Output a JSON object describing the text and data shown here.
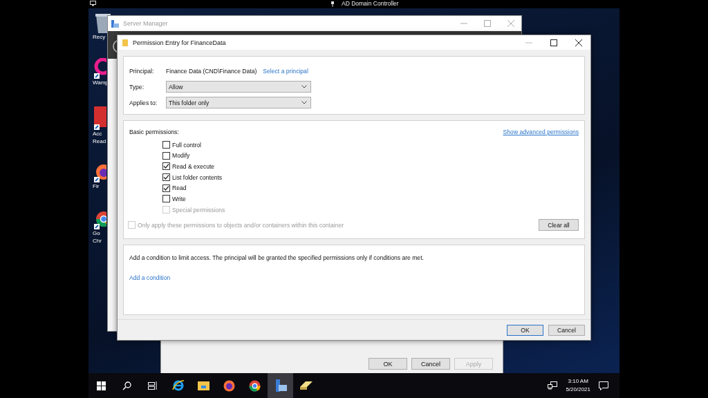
{
  "top_bar": {
    "title": "AD Domain Controller"
  },
  "desktop_icons": [
    {
      "kind": "recycle",
      "lines": [
        "Recy"
      ]
    },
    {
      "kind": "wamp",
      "lines": [
        "Wamp"
      ]
    },
    {
      "kind": "acrobat",
      "lines": [
        "Acc",
        "Read"
      ]
    },
    {
      "kind": "firefox",
      "lines": [
        "Fir"
      ]
    },
    {
      "kind": "chrome",
      "lines": [
        "Go",
        "Chr"
      ]
    }
  ],
  "server_manager": {
    "title": "Server Manager"
  },
  "properties_window": {
    "buttons": [
      {
        "label": "OK",
        "disabled": false
      },
      {
        "label": "Cancel",
        "disabled": false
      },
      {
        "label": "Apply",
        "disabled": true
      }
    ]
  },
  "dialog": {
    "title": "Permission Entry for FinanceData",
    "principal_label": "Principal:",
    "principal": "Finance Data (CND\\Finance Data)",
    "select_principal": "Select a principal",
    "type": {
      "label": "Type:",
      "value": "Allow"
    },
    "applies_to": {
      "label": "Applies to:",
      "value": "This folder only"
    },
    "basic_permissions_label": "Basic permissions:",
    "advanced_link": "Show advanced permissions",
    "permissions": [
      {
        "label": "Full control",
        "checked": false,
        "disabled": false
      },
      {
        "label": "Modify",
        "checked": false,
        "disabled": false
      },
      {
        "label": "Read & execute",
        "checked": true,
        "disabled": false
      },
      {
        "label": "List folder contents",
        "checked": true,
        "disabled": false
      },
      {
        "label": "Read",
        "checked": true,
        "disabled": false
      },
      {
        "label": "Write",
        "checked": false,
        "disabled": false
      },
      {
        "label": "Special permissions",
        "checked": false,
        "disabled": true
      }
    ],
    "only_apply": {
      "label": "Only apply these permissions to objects and/or containers within this container",
      "checked": false,
      "disabled": true
    },
    "clear_all": "Clear all",
    "condition_text": "Add a condition to limit access. The principal will be granted the specified permissions only if conditions are met.",
    "add_condition": "Add a condition",
    "buttons": [
      {
        "label": "OK",
        "default": true
      },
      {
        "label": "Cancel",
        "default": false
      }
    ]
  },
  "taskbar": {
    "apps": [
      {
        "kind": "start",
        "active": false
      },
      {
        "kind": "search",
        "active": false
      },
      {
        "kind": "taskview",
        "active": false
      },
      {
        "kind": "ie",
        "active": false
      },
      {
        "kind": "explorer",
        "active": false
      },
      {
        "kind": "firefox",
        "active": false
      },
      {
        "kind": "chrome",
        "active": false
      },
      {
        "kind": "servermanager",
        "active": true
      },
      {
        "kind": "eraser",
        "active": false
      }
    ],
    "time": "3:10 AM",
    "date": "5/20/2021"
  }
}
